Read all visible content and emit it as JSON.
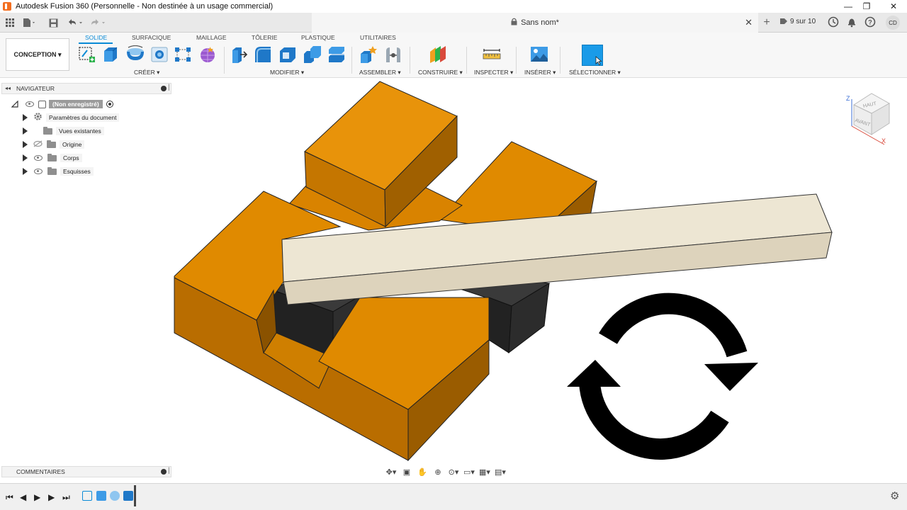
{
  "window": {
    "title": "Autodesk Fusion 360 (Personnelle - Non destinée à un usage commercial)",
    "minimize": "—",
    "maximize": "❐",
    "close": "✕"
  },
  "document": {
    "title": "Sans nom*",
    "close": "✕",
    "add": "+",
    "jobs": "9 sur 10",
    "avatar": "CD"
  },
  "ribbon": {
    "workspace": "CONCEPTION ▾",
    "tabs": [
      "SOLIDE",
      "SURFACIQUE",
      "MAILLAGE",
      "TÔLERIE",
      "PLASTIQUE",
      "UTILITAIRES"
    ],
    "active_tab": "SOLIDE",
    "groups": [
      "CRÉER ▾",
      "MODIFIER ▾",
      "ASSEMBLER ▾",
      "CONSTRUIRE ▾",
      "INSPECTER ▾",
      "INSÉRER ▾",
      "SÉLECTIONNER ▾"
    ]
  },
  "navigator": {
    "title": "NAVIGATEUR",
    "root": "(Non enregistré)",
    "items": [
      {
        "label": "Paramètres du document",
        "icon": "gear-icon"
      },
      {
        "label": "Vues existantes",
        "icon": "folder-icon"
      },
      {
        "label": "Origine",
        "icon": "folder-icon"
      },
      {
        "label": "Corps",
        "icon": "folder-icon"
      },
      {
        "label": "Esquisses",
        "icon": "folder-icon"
      }
    ]
  },
  "viewcube": {
    "top": "HAUT",
    "front": "AVANT",
    "x": "X",
    "z": "Z"
  },
  "comments": {
    "title": "COMMENTAIRES"
  },
  "colors": {
    "accent": "#0a8bd6",
    "orange_body": "#e08a00",
    "beam": "#ece4d2",
    "dark_body": "#2b2b2b"
  }
}
